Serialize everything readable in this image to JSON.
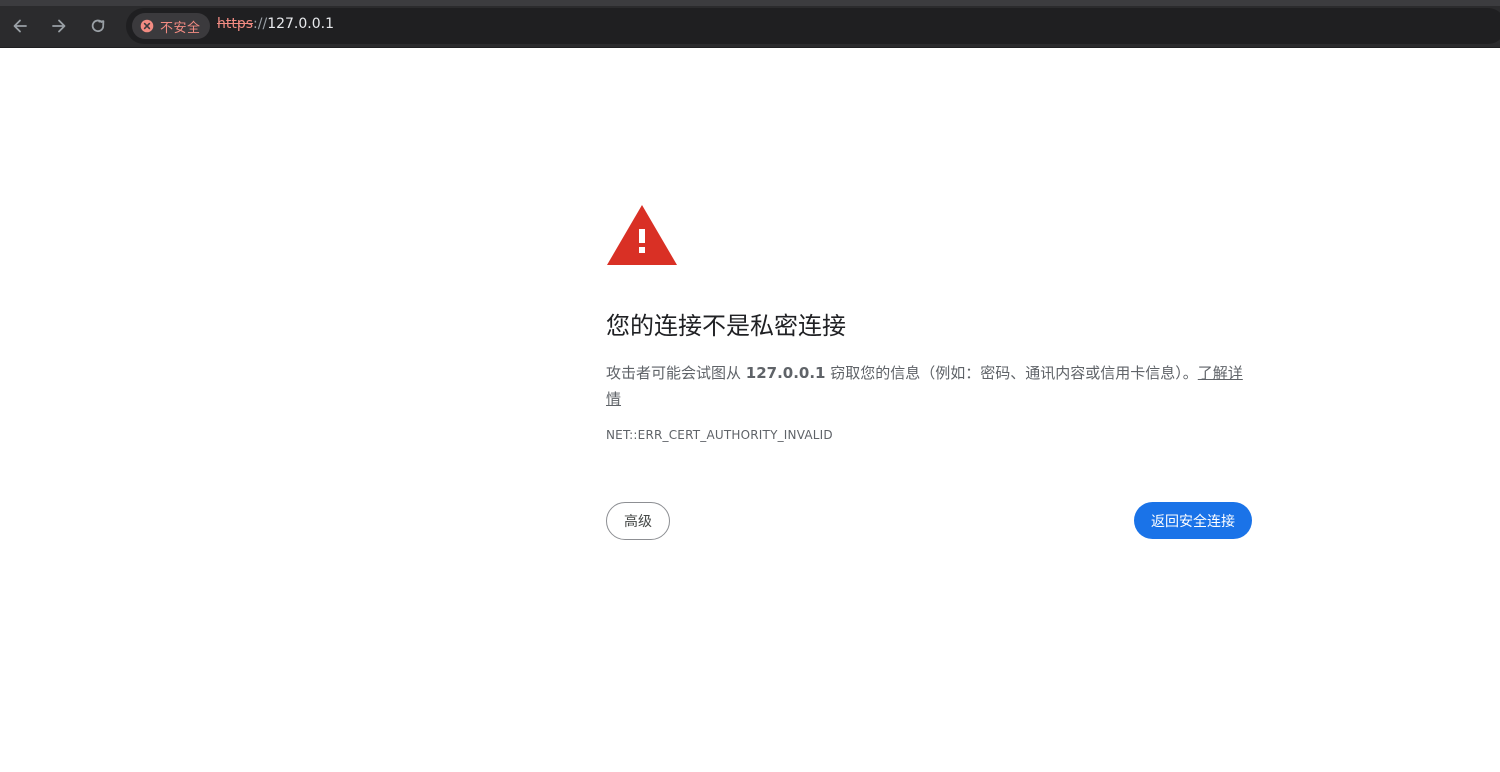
{
  "toolbar": {
    "security_chip_label": "不安全",
    "url_scheme": "https",
    "url_separator": "://",
    "url_host": "127.0.0.1"
  },
  "interstitial": {
    "heading": "您的连接不是私密连接",
    "explanation_prefix": "攻击者可能会试图从 ",
    "explanation_host": "127.0.0.1",
    "explanation_suffix": " 窃取您的信息（例如：密码、通讯内容或信用卡信息）。",
    "learn_more_link": "了解详情",
    "error_code": "NET::ERR_CERT_AUTHORITY_INVALID",
    "advanced_button": "高级",
    "back_to_safety_button": "返回安全连接"
  },
  "colors": {
    "warning_red": "#d93025",
    "primary_blue": "#1a73e8",
    "insecure_red": "#f28b82",
    "toolbar_bg": "#2b2b2d"
  },
  "icons": [
    "back-arrow-icon",
    "forward-arrow-icon",
    "reload-icon",
    "not-secure-icon",
    "warning-triangle-icon"
  ]
}
